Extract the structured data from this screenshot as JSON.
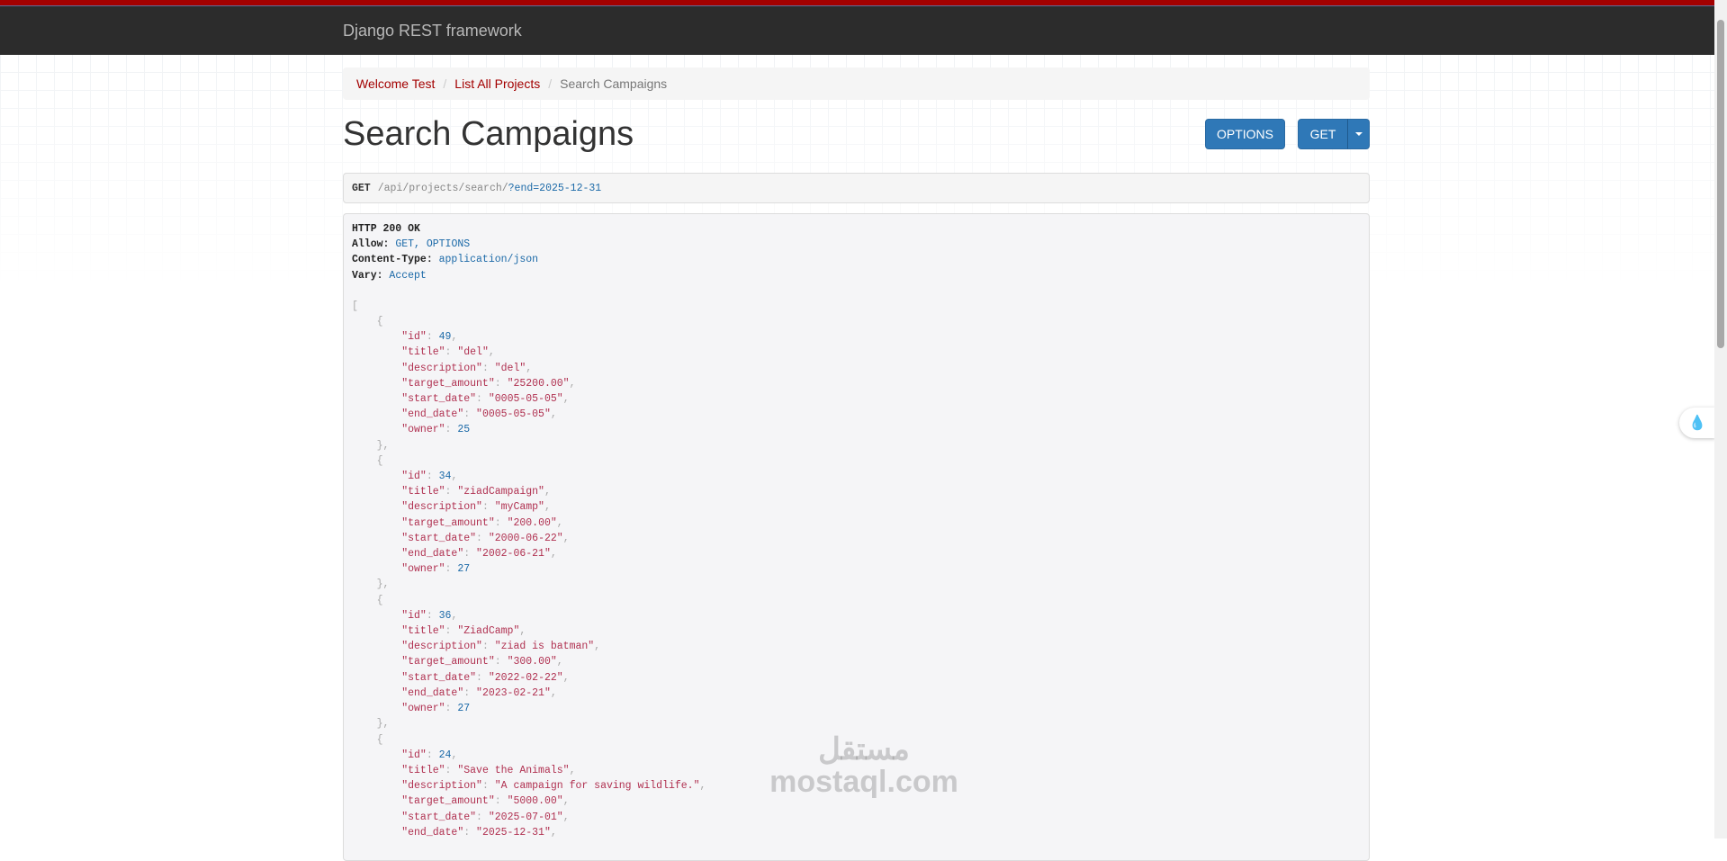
{
  "brand": "Django REST framework",
  "breadcrumb": {
    "items": [
      "Welcome Test",
      "List All Projects"
    ],
    "active": "Search Campaigns"
  },
  "title": "Search Campaigns",
  "buttons": {
    "options": "OPTIONS",
    "get": "GET"
  },
  "request": {
    "method": "GET",
    "path": "/api/projects/search/",
    "query": "?end=2025-12-31"
  },
  "response": {
    "status": "HTTP 200 OK",
    "headers": [
      {
        "key": "Allow:",
        "value": "GET, OPTIONS"
      },
      {
        "key": "Content-Type:",
        "value": "application/json"
      },
      {
        "key": "Vary:",
        "value": "Accept"
      }
    ],
    "items": [
      {
        "id": 49,
        "title": "del",
        "description": "del",
        "target_amount": "25200.00",
        "start_date": "0005-05-05",
        "end_date": "0005-05-05",
        "owner": 25
      },
      {
        "id": 34,
        "title": "ziadCampaign",
        "description": "myCamp",
        "target_amount": "200.00",
        "start_date": "2000-06-22",
        "end_date": "2002-06-21",
        "owner": 27
      },
      {
        "id": 36,
        "title": "ZiadCamp",
        "description": "ziad is batman",
        "target_amount": "300.00",
        "start_date": "2022-02-22",
        "end_date": "2023-02-21",
        "owner": 27
      },
      {
        "id": 24,
        "title": "Save the Animals",
        "description": "A campaign for saving wildlife.",
        "target_amount": "5000.00",
        "start_date": "2025-07-01",
        "end_date": "2025-12-31"
      }
    ]
  },
  "watermark": {
    "arabic": "مستقل",
    "latin": "mostaql.com"
  },
  "colors": {
    "topbar": "#2c2c2c",
    "accent": "#a30000",
    "button": "#2f78b7"
  }
}
